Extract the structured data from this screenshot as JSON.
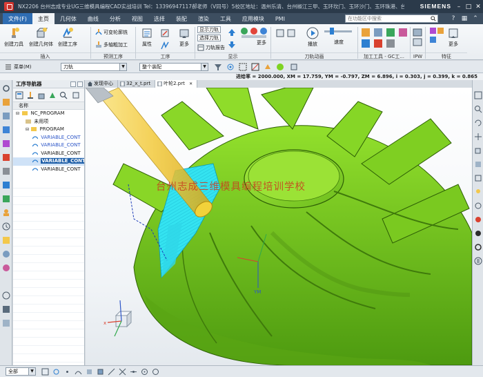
{
  "title": {
    "text": "NX2206 台州志成专业UG三维模具编程CAD实战培训  Tel：13396947117郝老师（V同号）5校区地址：温州乐清、台州椒江三甲、玉环坎门、玉环沙门、玉环珠港、台州路桥 · 加工",
    "brand": "SIEMENS",
    "controls": [
      "–",
      "□",
      "✕"
    ]
  },
  "menu": {
    "file": "文件(F)",
    "tabs": [
      "主页",
      "几何体",
      "曲线",
      "分析",
      "视图",
      "选择",
      "装配",
      "渲染",
      "工具",
      "应用模块",
      "PMI"
    ],
    "active_tab": "主页",
    "search_placeholder": "在功能区中搜索"
  },
  "ribbon": {
    "buttons": {
      "create_tool": "创建刀具",
      "create_geometry": "创建几何体",
      "create_operation": "创建工序",
      "variable_contour": "可变轮廓铣",
      "multi_axis_rough": "多轴粗加工",
      "attribute": "属性",
      "tool_display": "工序",
      "more1": "更多",
      "more2": "更多",
      "more3": "更多",
      "playback": "播放",
      "speed": "速度"
    },
    "toggles": {
      "show_toolpath": "显示刀轨",
      "select_toolpath": "选择刀轨",
      "toolpath_report": "刀轨报告"
    },
    "groups": [
      "插入",
      "预测工序",
      "工序",
      "显示",
      "刀轨动画",
      "加工工具 - GC工...",
      "IPW",
      "特征"
    ]
  },
  "selbar": {
    "menu": "菜单(M)",
    "filter": "刀轨",
    "scope": "整个装配"
  },
  "status": {
    "text": "进给率 = 2000.000, XM = 17.759, YM = -0.797, ZM = 6.896, i = 0.303, j = 0.399, k = 0.865"
  },
  "navigator": {
    "title": "工序导航器",
    "column": "名称",
    "rows": [
      {
        "label": "NC_PROGRAM",
        "indent": 0
      },
      {
        "label": "未用项",
        "indent": 1
      },
      {
        "label": "PROGRAM",
        "indent": 1
      },
      {
        "label": "VARIABLE_CONT",
        "indent": 2
      },
      {
        "label": "VARIABLE_CONT",
        "indent": 2
      },
      {
        "label": "VARIABLE_CONT",
        "indent": 2
      },
      {
        "label": "VARIABLE_CONT",
        "indent": 2
      },
      {
        "label": "VARIABLE_CONT",
        "indent": 2
      }
    ],
    "selected_index": 6
  },
  "graphics": {
    "tabs": [
      "发现中心",
      "32_x_t.prt",
      "叶轮2.prt"
    ],
    "active_tab": "叶轮2.prt",
    "watermark": "台州志成三维模具编程培训学校",
    "axis_label": "YM"
  },
  "bottom": {
    "filter": "全部"
  },
  "colors": {
    "title_bg": "#2b3a4a",
    "menu_bg": "#3d4e60",
    "accent": "#2f6db3",
    "part_green": "#7ed321",
    "toolpath_cyan": "#35e6f2",
    "tool_yellow": "#f2d23a"
  }
}
